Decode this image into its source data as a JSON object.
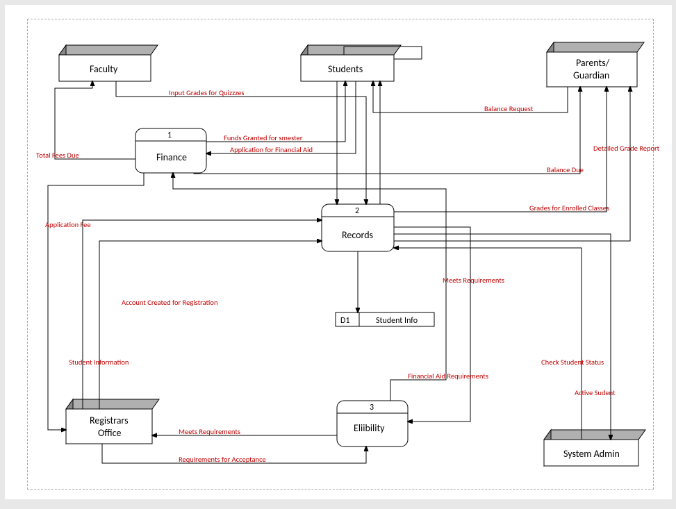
{
  "entities": {
    "faculty": "Faculty",
    "students": "Students",
    "parents": "Parents/",
    "parents2": "Guardian",
    "registrars1": "Registrars",
    "registrars2": "Office",
    "sysadmin": "System Admin"
  },
  "processes": {
    "p1_num": "1",
    "p1_name": "Finance",
    "p2_num": "2",
    "p2_name": "Records",
    "p3_num": "3",
    "p3_name": "Eliibility"
  },
  "datastore": {
    "d1_id": "D1",
    "d1_name": "Student Info"
  },
  "flows": {
    "input_grades": "Input Grades for Quizzzes",
    "balance_request": "Balance Request",
    "funds_granted": "Funds Granted for smester",
    "app_finaid": "Application for Financial Aid",
    "total_fees": "Total Fees Due",
    "balance_due": "Balance Due",
    "detailed_grade": "Detailed Grade Report",
    "grades_enrolled": "Grades for Enrolled Classes",
    "application_fee": "Application Fee",
    "account_created": "Account Created for Registration",
    "meets_req": "Meets Requirements",
    "student_info": "Student Information",
    "financial_aid_req": "Financial Aid  Requirements",
    "check_status": "Check Student Status",
    "active_student": "Active Sudent",
    "meets_req2": "Meets Requirements",
    "req_acceptance": "Requirements for Acceptance"
  }
}
